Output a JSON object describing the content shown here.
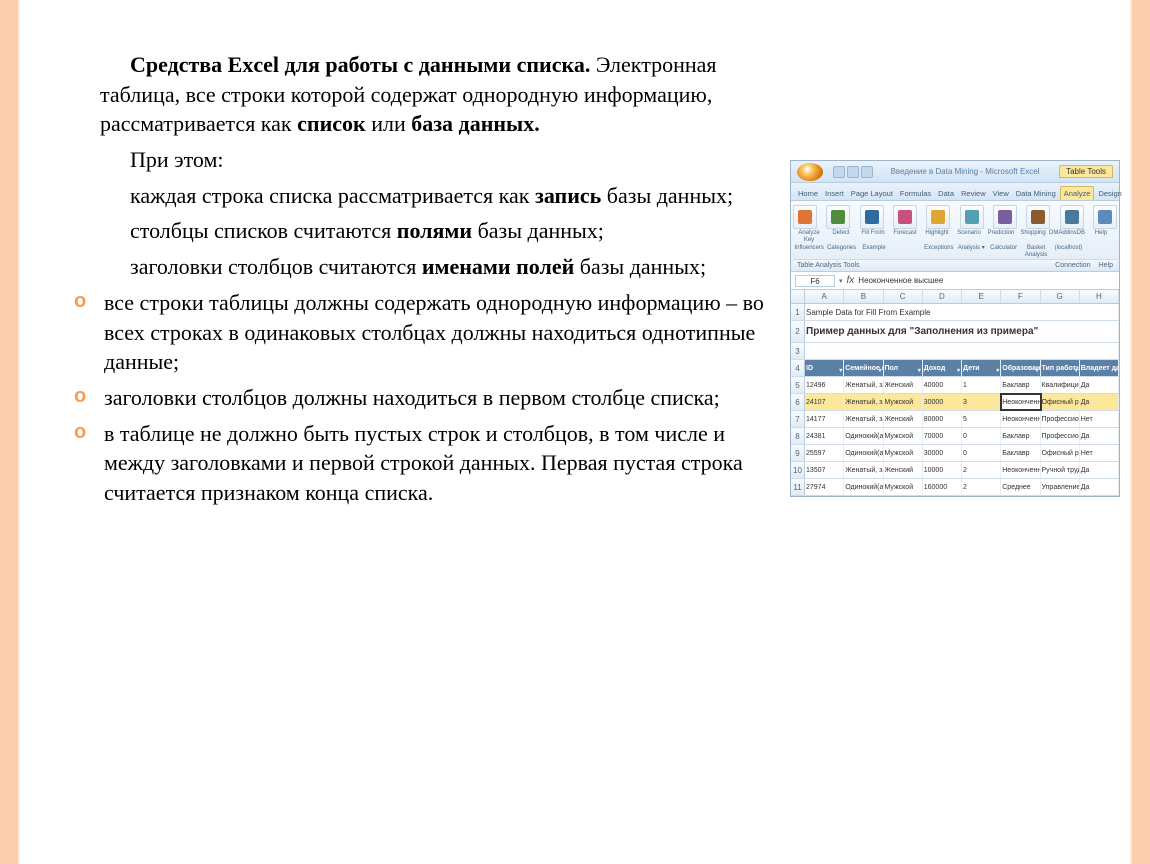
{
  "text": {
    "heading_bold": "Средства Excel для работы с данными списка.",
    "heading_cont": " Электронная таблица, все строки которой содержат однородную информацию, рассматривается как ",
    "bold_list": "список",
    "or": " или ",
    "bold_db": "база данных.",
    "p2": "При этом:",
    "p3_pre": "каждая строка списка рассматривается как ",
    "p3_b": "запись ",
    "p3_post": "базы данных;",
    "p4_pre": "столбцы списков считаются ",
    "p4_b": "полями ",
    "p4_post": "базы данных;",
    "p5_pre": "заголовки столбцов считаются ",
    "p5_b": "именами полей ",
    "p5_post": "базы данных;",
    "b1": "все строки таблицы должны содержать однородную информацию – во всех строках в одинаковых столбцах должны находиться однотипные данные;",
    "b2": "заголовки столбцов должны находиться в первом столбце списка;",
    "b3": "в таблице не должно быть пустых строк и столбцов, в том числе и между заголовками и первой строкой данных. Первая пустая строка считается признаком конца списка."
  },
  "excel": {
    "title": "Введение в Data Mining - Microsoft Excel",
    "context_tab": "Table Tools",
    "tabs": [
      "Home",
      "Insert",
      "Page Layout",
      "Formulas",
      "Data",
      "Review",
      "View",
      "Data Mining",
      "Analyze",
      "Design"
    ],
    "active_tab_index": 8,
    "ribbon_labels_top": [
      "Analyze Key",
      "Detect",
      "Fill From",
      "Forecast",
      "Highlight",
      "Scenario",
      "Prediction",
      "Shopping",
      "DMAddinsDB",
      "Help"
    ],
    "ribbon_labels_bot": [
      "Influencers",
      "Categories",
      "Example",
      "",
      "Exceptions",
      "Analysis ▾",
      "Calculator",
      "Basket Analysis",
      "(localhost)",
      ""
    ],
    "group_left": "Table Analysis Tools",
    "group_right1": "Connection",
    "group_right2": "Help",
    "namebox": "F6",
    "fx_value": "Неоконченное высшее",
    "cols": [
      "A",
      "B",
      "C",
      "D",
      "E",
      "F",
      "G",
      "H"
    ],
    "row1_label": "1",
    "row1_text": "Sample Data for Fill From Example",
    "row2_label": "2",
    "row2_text": "Пример данных для \"Заполнения из примера\"",
    "row3_label": "3",
    "head_row_label": "4",
    "headers": [
      "ID",
      "Семейное поло",
      "Пол",
      "Доход",
      "Дети",
      "Образование",
      "Тип работы",
      "Владеет дом"
    ],
    "data": [
      {
        "n": "5",
        "cells": [
          "12496",
          "Женатый, замуже",
          "Женский",
          "40000",
          "1",
          "Баклавр",
          "Квалифициров",
          "Да"
        ]
      },
      {
        "n": "6",
        "cells": [
          "24107",
          "Женатый, замуже",
          "Мужской",
          "30000",
          "3",
          "Неоконченное выс",
          "Офисный работ",
          "Да"
        ],
        "selected": true,
        "active_col": 5
      },
      {
        "n": "7",
        "cells": [
          "14177",
          "Женатый, замуже",
          "Женский",
          "80000",
          "5",
          "Неоконченное выс",
          "Профессионал",
          "Нет"
        ]
      },
      {
        "n": "8",
        "cells": [
          "24381",
          "Одинокий(ая)",
          "Мужской",
          "70000",
          "0",
          "Баклавр",
          "Профессионал",
          "Да"
        ]
      },
      {
        "n": "9",
        "cells": [
          "25597",
          "Одинокий(ая)",
          "Мужской",
          "30000",
          "0",
          "Баклавр",
          "Офисный работ",
          "Нет"
        ]
      },
      {
        "n": "10",
        "cells": [
          "13507",
          "Женатый, замуже",
          "Женский",
          "10000",
          "2",
          "Неоконченное выс",
          "Ручной труд",
          "Да"
        ]
      },
      {
        "n": "11",
        "cells": [
          "27974",
          "Одинокий(ая)",
          "Мужской",
          "160000",
          "2",
          "Среднее",
          "Управление",
          "Да"
        ]
      }
    ]
  }
}
